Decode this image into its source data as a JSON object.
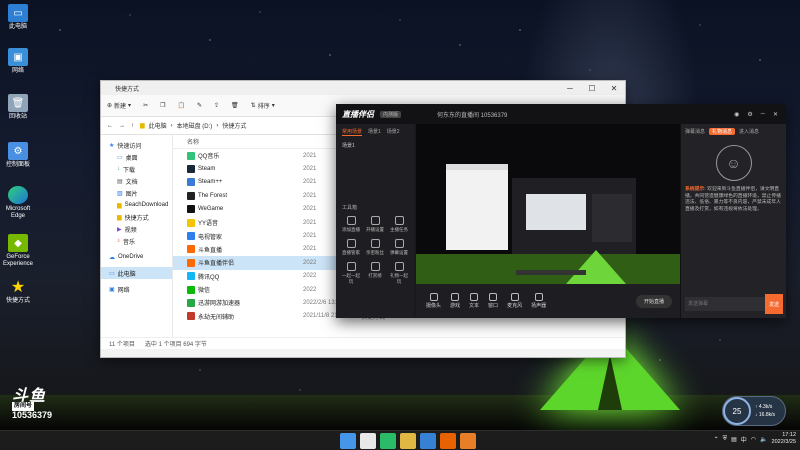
{
  "desktop": {
    "icons": [
      {
        "label": "此电脑",
        "icon": "computer-icon"
      },
      {
        "label": "网络",
        "icon": "network-icon"
      },
      {
        "label": "回收站",
        "icon": "recycle-bin-icon"
      },
      {
        "label": "控制面板",
        "icon": "control-panel-icon"
      },
      {
        "label": "Microsoft Edge",
        "icon": "edge-icon"
      },
      {
        "label": "GeForce Experience",
        "icon": "geforce-icon"
      },
      {
        "label": "快捷方式",
        "icon": "star-icon"
      }
    ]
  },
  "explorer": {
    "title": "快捷方式",
    "toolbar": {
      "new_label": "新建",
      "sort_label": "排序"
    },
    "breadcrumb": [
      "此电脑",
      "本地磁盘 (D:)",
      "快捷方式"
    ],
    "sidebar": [
      {
        "label": "快速访问"
      },
      {
        "label": "桌面"
      },
      {
        "label": "下载"
      },
      {
        "label": "文档"
      },
      {
        "label": "图片"
      },
      {
        "label": "SeachDownload"
      },
      {
        "label": "快捷方式"
      },
      {
        "label": "视频"
      },
      {
        "label": "音乐"
      },
      {
        "label": "OneDrive"
      },
      {
        "label": "此电脑"
      },
      {
        "label": "网络"
      }
    ],
    "header": {
      "name": "名称"
    },
    "files": [
      {
        "name": "QQ音乐",
        "date": "2021",
        "type": "",
        "size": "",
        "color": "#31c27c"
      },
      {
        "name": "Steam",
        "date": "2021",
        "type": "",
        "size": "",
        "color": "#1b2838"
      },
      {
        "name": "Steam++",
        "date": "2021",
        "type": "",
        "size": "",
        "color": "#3a7bd5"
      },
      {
        "name": "The Forest",
        "date": "2021",
        "type": "",
        "size": "",
        "color": "#222222"
      },
      {
        "name": "WeGame",
        "date": "2021",
        "type": "",
        "size": "",
        "color": "#111111"
      },
      {
        "name": "YY语音",
        "date": "2021",
        "type": "",
        "size": "",
        "color": "#f5c400"
      },
      {
        "name": "电视管家",
        "date": "2021",
        "type": "",
        "size": "",
        "color": "#2f80ed"
      },
      {
        "name": "斗鱼直播",
        "date": "2021",
        "type": "",
        "size": "",
        "color": "#ff6a00"
      },
      {
        "name": "斗鱼直播伴侣",
        "date": "2022",
        "type": "",
        "size": "",
        "color": "#ff6a00"
      },
      {
        "name": "腾讯QQ",
        "date": "2022",
        "type": "",
        "size": "",
        "color": "#12b7f5"
      },
      {
        "name": "微信",
        "date": "2022",
        "type": "",
        "size": "",
        "color": "#09bb07"
      },
      {
        "name": "迅游网游加速器",
        "date": "2022/2/6 13:26",
        "type": "快捷方式",
        "size": "1 KB",
        "color": "#28a745"
      },
      {
        "name": "永劫无间辅助",
        "date": "2021/11/8 21:07",
        "type": "快捷方式",
        "size": "1 KB",
        "color": "#c0392b"
      }
    ],
    "status": {
      "count": "11 个项目",
      "selected": "选中 1 个项目 694 字节"
    }
  },
  "douyu": {
    "logo": "直播伴侣",
    "badge": "内测版",
    "room_title": "何东东的直播间 10536379",
    "left_tabs": [
      "常用场景",
      "场景1",
      "场景2"
    ],
    "scene_label": "场景1",
    "tools_header": "工具箱",
    "tools": [
      {
        "label": "添加直播"
      },
      {
        "label": "开播设置"
      },
      {
        "label": "主播任务"
      },
      {
        "label": "直播管家"
      },
      {
        "label": "亲密粉丝"
      },
      {
        "label": "弹幕设置"
      },
      {
        "label": "一起一起玩"
      },
      {
        "label": "打赏榜"
      },
      {
        "label": "礼物一起玩"
      }
    ],
    "bottom": [
      {
        "label": "摄像头"
      },
      {
        "label": "游戏"
      },
      {
        "label": "文本"
      },
      {
        "label": "窗口"
      },
      {
        "label": "麦克风"
      },
      {
        "label": "扬声器"
      }
    ],
    "start_label": "开始直播",
    "right_tabs": [
      "弹幕消息",
      "礼物消息",
      "进入消息"
    ],
    "notice_highlight": "系统提示:",
    "notice": "欢迎来到斗鱼直播伴侣，请文明直播，共同营造健康绿色的直播环境，禁止传播违法、低俗、暴力等不良内容，严禁未成年人直播及打赏，如有违规将依法处理。",
    "input_placeholder": "发送弹幕",
    "send_label": "发送"
  },
  "watermark": {
    "brand": "斗鱼",
    "room_label": "房间号",
    "room_number": "10536379"
  },
  "weather": {
    "temp": "25",
    "up": "4.3k/s",
    "down": "16.8k/s"
  },
  "taskbar": {
    "apps": [
      {
        "icon": "start-icon",
        "color": "#4aa3ff"
      },
      {
        "icon": "search-icon",
        "color": "#ffffff"
      },
      {
        "icon": "edge-icon",
        "color": "#2ecc71"
      },
      {
        "icon": "file-explorer-icon",
        "color": "#f7c948"
      },
      {
        "icon": "store-icon",
        "color": "#3a8de8"
      },
      {
        "icon": "douyu-icon",
        "color": "#ff6a00"
      },
      {
        "icon": "douyu-companion-icon",
        "color": "#ff8a2a"
      }
    ],
    "time": "17:12",
    "date": "2022/3/25",
    "lang": "中"
  }
}
